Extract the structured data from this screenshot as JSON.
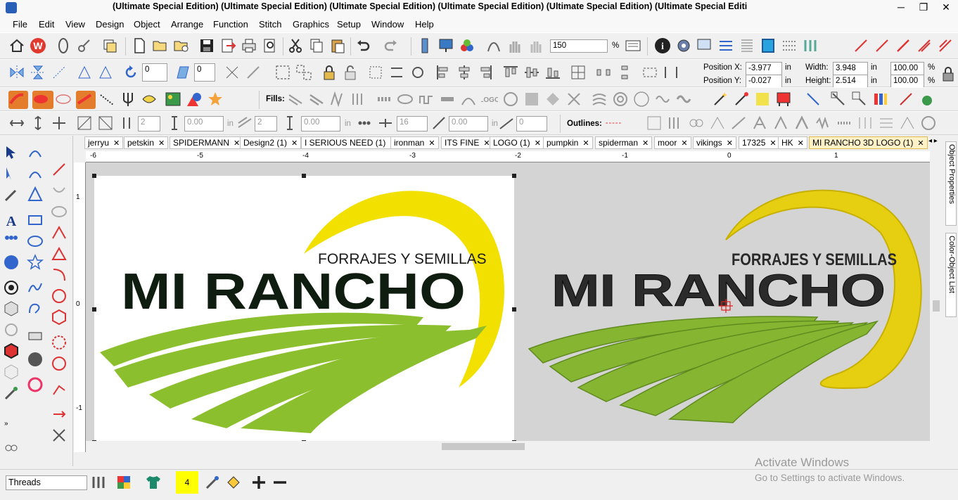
{
  "window": {
    "title": "(Ultimate Special Edition) (Ultimate Special Edition) (Ultimate Special Edition) (Ultimate Special Edition) (Ultimate Special Edition) (Ultimate Special Editi",
    "minimize": "─",
    "restore": "❐",
    "close": "✕"
  },
  "menu": [
    "File",
    "Edit",
    "View",
    "Design",
    "Object",
    "Arrange",
    "Function",
    "Stitch",
    "Graphics",
    "Setup",
    "Window",
    "Help"
  ],
  "toolbar1": {
    "zoom": "150",
    "zoom_unit": "%"
  },
  "toolbar2": {
    "rotate_value": "0",
    "slant_value": "0",
    "position_x_label": "Position X:",
    "position_x": "-3.977",
    "position_y_label": "Position Y:",
    "position_y": "-0.027",
    "unit_in": "in",
    "width_label": "Width:",
    "width": "3.948",
    "height_label": "Height:",
    "height": "2.514",
    "scale_w": "100.00",
    "scale_h": "100.00",
    "pct": "%"
  },
  "toolbar3": {
    "fills_label": "Fills:"
  },
  "toolbar4": {
    "val1": "2",
    "val2": "0.00",
    "unit1": "in",
    "val3": "2",
    "val4": "0.00",
    "unit2": "in",
    "val5": "16",
    "val6": "0.00",
    "unit3": "in",
    "val7": "0",
    "outlines_label": "Outlines:"
  },
  "tabs": [
    {
      "label": "jerryu"
    },
    {
      "label": "petskin"
    },
    {
      "label": "SPIDERMANN"
    },
    {
      "label": "Design2 (1)"
    },
    {
      "label": "I SERIOUS NEED (1)"
    },
    {
      "label": "ironman"
    },
    {
      "label": "ITS FINE"
    },
    {
      "label": "LOGO (1)"
    },
    {
      "label": "pumpkin"
    },
    {
      "label": "spiderman"
    },
    {
      "label": "moor"
    },
    {
      "label": "vikings"
    },
    {
      "label": "17325"
    },
    {
      "label": "HK"
    },
    {
      "label": "MI RANCHO 3D LOGO (1)"
    }
  ],
  "tab_close": "✕",
  "ruler": {
    "top_labels": [
      "-6",
      "-5",
      "-4",
      "-3",
      "-2",
      "-1",
      "0",
      "1"
    ],
    "left_labels": [
      "1",
      "0",
      "-1"
    ]
  },
  "artwork": {
    "subtitle": "FORRAJES Y SEMILLAS",
    "title": "MI RANCHO"
  },
  "right_panel": {
    "tab1": "Object Properties",
    "tab2": "Color-Object List"
  },
  "status": {
    "threads_select": "Threads",
    "thread_count": "4",
    "watermark_line1": "Activate Windows",
    "watermark_line2": "Go to Settings to activate Windows."
  },
  "colors": {
    "green": "#8cbf2d",
    "yellow": "#f2e000",
    "black_text": "#0f1d10",
    "accent_tab": "#fdf1c8"
  }
}
